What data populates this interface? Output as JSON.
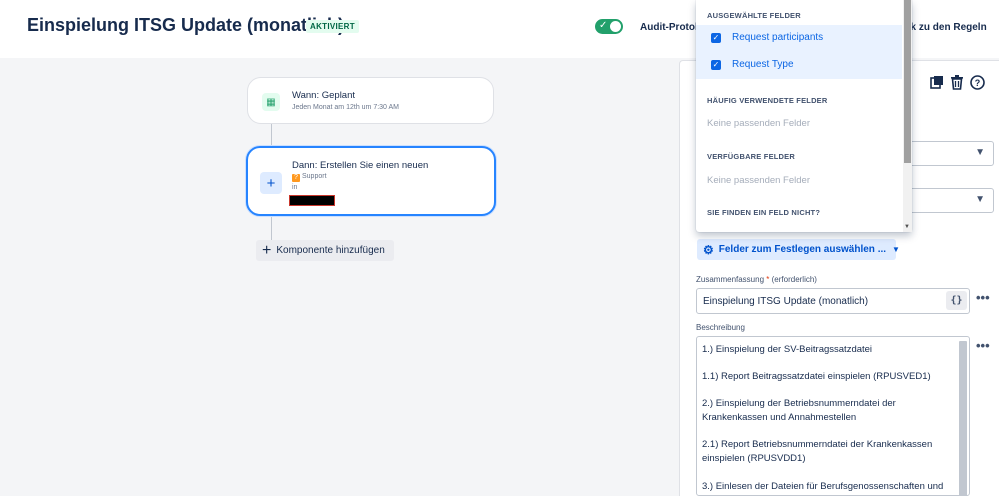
{
  "header": {
    "title": "Einspielung ITSG Update (monatlich)",
    "status_badge": "AKTIVIERT",
    "audit_label": "Audit-Protok",
    "back_label": "ck zu den Regeln"
  },
  "flow": {
    "trigger": {
      "title": "Wann: Geplant",
      "subtitle": "Jeden Monat am 12th um 7:30 AM"
    },
    "action": {
      "title": "Dann: Erstellen Sie einen neuen",
      "type": "Support",
      "in_label": "in"
    },
    "add_component_label": "Komponente hinzufügen"
  },
  "field_picker": {
    "sections": [
      {
        "heading": "AUSGEWÄHLTE FELDER",
        "items": [
          "Request participants",
          "Request Type"
        ]
      },
      {
        "heading": "HÄUFIG VERWENDETE FELDER",
        "empty": "Keine passenden Felder"
      },
      {
        "heading": "VERFÜGBARE FELDER",
        "empty": "Keine passenden Felder"
      },
      {
        "heading": "SIE FINDEN EIN FELD NICHT?"
      }
    ]
  },
  "form": {
    "fields_button_label": "Felder zum Festlegen auswählen ...",
    "summary": {
      "label": "Zusammenfassung",
      "required_mark": "*",
      "required_text": "(erforderlich)",
      "value": "Einspielung ITSG Update (monatlich)",
      "smart_value_button": "{}"
    },
    "description": {
      "label": "Beschreibung",
      "lines": [
        "1.) Einspielung der SV-Beitragssatzdatei",
        "1.1) Report Beitragssatzdatei einspielen (RPUSVED1)",
        "2.) Einspielung der Betriebsnummerndatei der Krankenkassen und Annahmestellen",
        "2.1) Report Betriebsnummerndatei der Krankenkassen einspielen (RPUSVDD1)",
        "3.) Einlesen der Dateien für Berufsgenossenschaften und"
      ]
    },
    "more_label": "•••"
  },
  "colors": {
    "accent": "#0c66e4",
    "success": "#22a06b",
    "selected_border": "#2684ff"
  }
}
